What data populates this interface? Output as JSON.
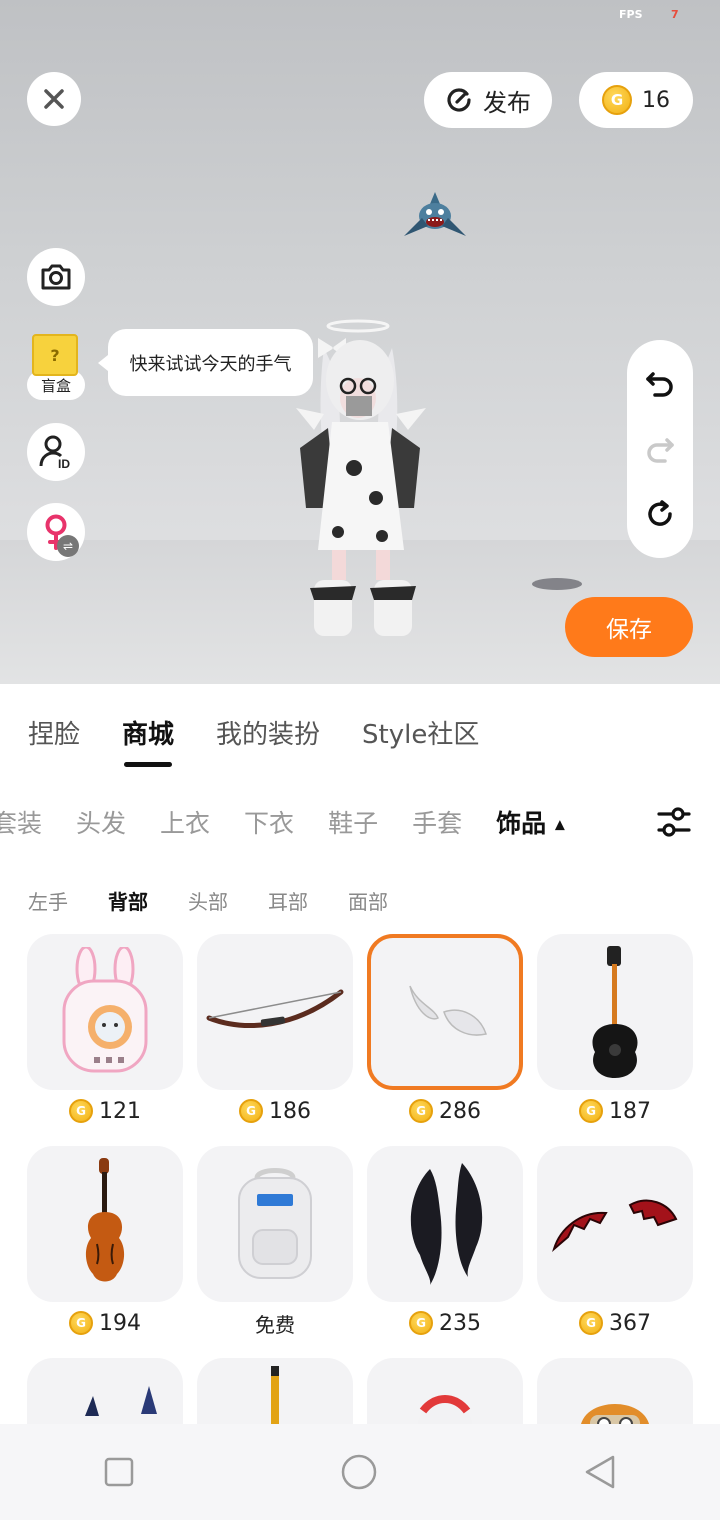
{
  "fps": {
    "label": "FPS",
    "value": "7"
  },
  "header": {
    "publish_label": "发布",
    "coins": "16"
  },
  "left_tools": {
    "blindbox_label": "盲盒",
    "blindbox_mark": "?",
    "bubble_text": "快来试试今天的手气"
  },
  "save_label": "保存",
  "main_tabs": [
    {
      "label": "捏脸",
      "active": false
    },
    {
      "label": "商城",
      "active": true
    },
    {
      "label": "我的装扮",
      "active": false
    },
    {
      "label": "Style社区",
      "active": false
    }
  ],
  "category_tabs": [
    {
      "label": "套装",
      "active": false
    },
    {
      "label": "头发",
      "active": false
    },
    {
      "label": "上衣",
      "active": false
    },
    {
      "label": "下衣",
      "active": false
    },
    {
      "label": "鞋子",
      "active": false
    },
    {
      "label": "手套",
      "active": false
    },
    {
      "label": "饰品",
      "active": true
    }
  ],
  "category_active_arrow": "▲",
  "sub_tabs": [
    {
      "label": "左手",
      "active": false
    },
    {
      "label": "背部",
      "active": true
    },
    {
      "label": "头部",
      "active": false
    },
    {
      "label": "耳部",
      "active": false
    },
    {
      "label": "面部",
      "active": false
    }
  ],
  "coin_glyph": "G",
  "items": [
    {
      "name": "bunny-backpack",
      "price": "121",
      "selected": false
    },
    {
      "name": "bow",
      "price": "186",
      "selected": false
    },
    {
      "name": "white-wings",
      "price": "286",
      "selected": true
    },
    {
      "name": "guitar",
      "price": "187",
      "selected": false
    },
    {
      "name": "violin",
      "price": "194",
      "selected": false
    },
    {
      "name": "white-backpack",
      "price": "免费",
      "free": true,
      "selected": false
    },
    {
      "name": "black-wings",
      "price": "235",
      "selected": false
    },
    {
      "name": "devil-wings",
      "price": "367",
      "selected": false
    },
    {
      "name": "item-9",
      "price": "",
      "selected": false
    },
    {
      "name": "item-10",
      "price": "",
      "selected": false
    },
    {
      "name": "item-11",
      "price": "",
      "selected": false
    },
    {
      "name": "item-12",
      "price": "",
      "selected": false
    }
  ],
  "colors": {
    "accent": "#ff7a1a",
    "coin": "#f2b114",
    "selected_border": "#f07a22"
  }
}
